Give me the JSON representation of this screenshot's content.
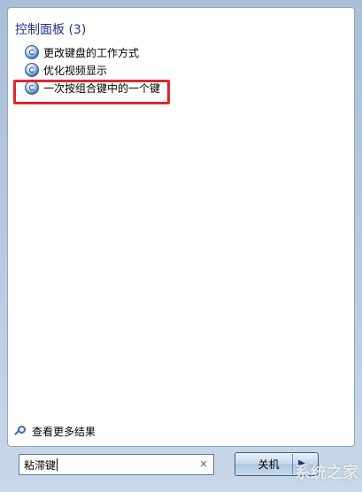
{
  "panel": {
    "group_title": "控制面板 (3)",
    "results": [
      {
        "label": "更改键盘的工作方式"
      },
      {
        "label": "优化视频显示"
      },
      {
        "label": "一次按组合键中的一个键"
      }
    ],
    "see_more": "查看更多结果"
  },
  "search": {
    "value": "粘滞键",
    "clear": "×"
  },
  "shutdown": {
    "label": "关机",
    "arrow": "▶"
  },
  "watermark": "系统之家",
  "colors": {
    "highlight": "#e0262d",
    "group_title": "#1e3287"
  }
}
